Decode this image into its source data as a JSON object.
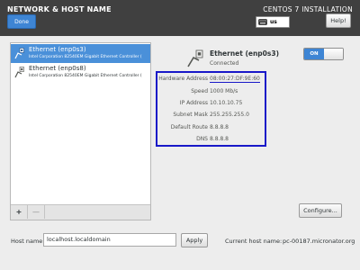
{
  "header": {
    "screen_title": "NETWORK & HOST NAME",
    "done_label": "Done",
    "product_title": "CENTOS 7 INSTALLATION",
    "keyboard_layout": "us",
    "help_label": "Help!"
  },
  "devices": [
    {
      "name": "Ethernet (enp0s3)",
      "description": "Intel Corporation 82540EM Gigabit Ethernet Controller (",
      "selected": true
    },
    {
      "name": "Ethernet (enp0s8)",
      "description": "Intel Corporation 82540EM Gigabit Ethernet Controller (",
      "selected": false
    }
  ],
  "list_controls": {
    "add_label": "+",
    "remove_label": "—"
  },
  "detail": {
    "name": "Ethernet (enp0s3)",
    "status": "Connected",
    "toggle_label": "ON",
    "toggle_on": true,
    "properties": [
      {
        "label": "Hardware Address",
        "value": "08:00:27:DF:9E:60"
      },
      {
        "label": "Speed",
        "value": "1000 Mb/s"
      },
      {
        "label": "IP Address",
        "value": "10.10.10.75"
      },
      {
        "label": "Subnet Mask",
        "value": "255.255.255.0"
      },
      {
        "label": "Default Route",
        "value": "8.8.8.8"
      },
      {
        "label": "DNS",
        "value": "8.8.8.8"
      }
    ],
    "configure_label": "Configure..."
  },
  "hostname": {
    "label": "Host name:",
    "value": "localhost.localdomain",
    "apply_label": "Apply",
    "current_label": "Current host name:",
    "current_value": "pc-00187.micronator.org"
  },
  "colors": {
    "accent": "#3e85d4",
    "selection": "#4a90d9",
    "highlight_box": "#1818c8",
    "topbar": "#404040"
  },
  "icons": {
    "keyboard": "keyboard-icon",
    "network": "network-wired-icon"
  }
}
